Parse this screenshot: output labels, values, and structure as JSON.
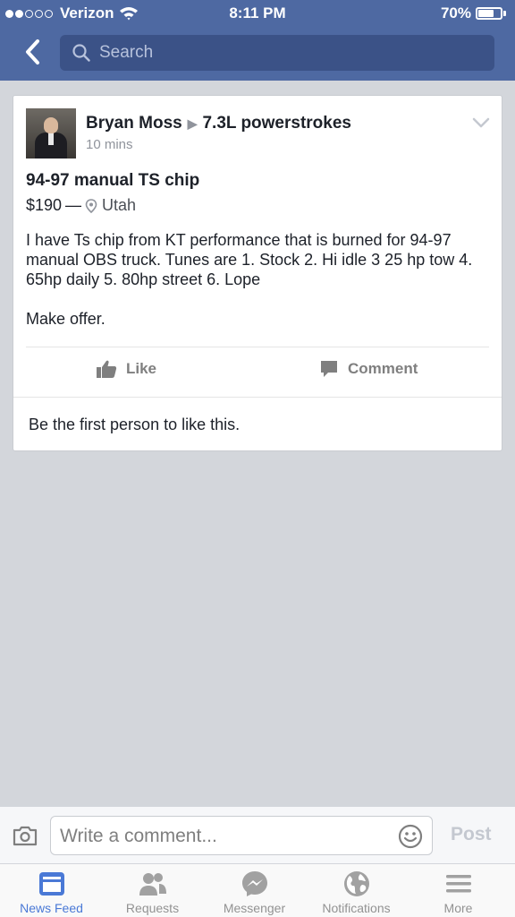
{
  "status_bar": {
    "carrier": "Verizon",
    "time": "8:11 PM",
    "battery": "70%",
    "battery_level": 0.7
  },
  "nav": {
    "back_icon": "chevron-left-icon",
    "search_placeholder": "Search"
  },
  "post": {
    "author": "Bryan Moss",
    "group": "7.3L powerstrokes",
    "time_ago": "10 mins",
    "title": "94-97 manual TS chip",
    "price": "$190",
    "location": "Utah",
    "body": "I have Ts chip from KT performance that is burned for 94-97 manual OBS truck.  Tunes are 1. Stock 2. Hi idle 3 25 hp tow 4. 65hp daily 5. 80hp street 6. Lope",
    "body2": "Make offer.",
    "like_label": "Like",
    "comment_label": "Comment",
    "likes_summary": "Be the first person to like this."
  },
  "composer": {
    "placeholder": "Write a comment...",
    "post_label": "Post"
  },
  "tabs": [
    {
      "label": "News Feed",
      "icon": "news-feed-icon",
      "active": true
    },
    {
      "label": "Requests",
      "icon": "friend-requests-icon",
      "active": false
    },
    {
      "label": "Messenger",
      "icon": "messenger-icon",
      "active": false
    },
    {
      "label": "Notifications",
      "icon": "globe-icon",
      "active": false
    },
    {
      "label": "More",
      "icon": "menu-icon",
      "active": false
    }
  ],
  "colors": {
    "header": "#4e69a2",
    "search_bg": "#3b5287",
    "active_tab": "#4a79d6",
    "inactive_tab": "#929292"
  }
}
